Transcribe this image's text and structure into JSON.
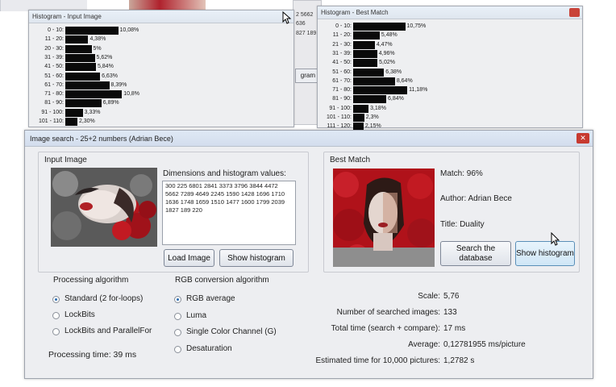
{
  "histogram_input": {
    "title": "Histogram - Input Image",
    "rows": [
      {
        "label": "0 - 10:",
        "pct": "10,08%",
        "value": 10.08
      },
      {
        "label": "11 - 20:",
        "pct": "4,38%",
        "value": 4.38
      },
      {
        "label": "20 - 30:",
        "pct": "5%",
        "value": 5.0
      },
      {
        "label": "31 - 39:",
        "pct": "5,62%",
        "value": 5.62
      },
      {
        "label": "41 - 50:",
        "pct": "5,84%",
        "value": 5.84
      },
      {
        "label": "51 - 60:",
        "pct": "6,63%",
        "value": 6.63
      },
      {
        "label": "61 - 70:",
        "pct": "8,39%",
        "value": 8.39
      },
      {
        "label": "71 - 80:",
        "pct": "10,8%",
        "value": 10.8
      },
      {
        "label": "81 - 90:",
        "pct": "6,89%",
        "value": 6.89
      },
      {
        "label": "91 - 100:",
        "pct": "3,33%",
        "value": 3.33
      },
      {
        "label": "101 - 110:",
        "pct": "2,30%",
        "value": 2.3
      }
    ]
  },
  "histogram_best": {
    "title": "Histogram - Best Match",
    "rows": [
      {
        "label": "0 - 10:",
        "pct": "10,75%",
        "value": 10.75
      },
      {
        "label": "11 - 20:",
        "pct": "5,48%",
        "value": 5.48
      },
      {
        "label": "21 - 30:",
        "pct": "4,47%",
        "value": 4.47
      },
      {
        "label": "31 - 39:",
        "pct": "4,96%",
        "value": 4.96
      },
      {
        "label": "41 - 50:",
        "pct": "5,02%",
        "value": 5.02
      },
      {
        "label": "51 - 60:",
        "pct": "6,38%",
        "value": 6.38
      },
      {
        "label": "61 - 70:",
        "pct": "8,64%",
        "value": 8.64
      },
      {
        "label": "71 - 80:",
        "pct": "11,18%",
        "value": 11.18
      },
      {
        "label": "81 - 90:",
        "pct": "6,84%",
        "value": 6.84
      },
      {
        "label": "91 - 100:",
        "pct": "3,18%",
        "value": 3.18
      },
      {
        "label": "101 - 110:",
        "pct": "2,3%",
        "value": 2.3
      },
      {
        "label": "111 - 120:",
        "pct": "2,15%",
        "value": 2.15
      }
    ]
  },
  "background": {
    "fragments": [
      "2 5662",
      "636",
      "827 189"
    ],
    "button_fragment": "gram"
  },
  "main": {
    "title": "Image search - 25+2 numbers (Adrian Bece)",
    "close_glyph": "✕",
    "input_group": "Input Image",
    "dims_label": "Dimensions and histogram values:",
    "dims_value": "300 225 6801 2841 3373 3796 3844 4472 5662 7289 4649 2245 1590 1428 1696 1710 1636 1748 1659 1510 1477 1600 1799 2039 1827 189 220",
    "load_button": "Load Image",
    "show_hist_button": "Show histogram",
    "proc_group": "Processing algorithm",
    "proc_options": [
      "Standard (2 for-loops)",
      "LockBits",
      "LockBits and ParallelFor"
    ],
    "proc_selected": 0,
    "proc_time": "Processing time: 39 ms",
    "rgb_group": "RGB conversion algorithm",
    "rgb_options": [
      "RGB average",
      "Luma",
      "Single Color Channel (G)",
      "Desaturation"
    ],
    "rgb_selected": 0,
    "best_group": "Best Match",
    "match": "Match: 96%",
    "author": "Author: Adrian Bece",
    "title_label": "Title:  Duality",
    "search_button": "Search the database",
    "show_hist_button2": "Show histogram",
    "stats": [
      {
        "label": "Scale:",
        "value": "5,76"
      },
      {
        "label": "Number of searched images:",
        "value": "133"
      },
      {
        "label": "Total time (search + compare):",
        "value": "17 ms"
      },
      {
        "label": "Average:",
        "value": "0,12781955 ms/picture"
      },
      {
        "label": "Estimated time for 10,000 pictures:",
        "value": "1,2782 s"
      }
    ]
  },
  "colors": {
    "bar": "#0a0a0a",
    "rose": "#b3151c",
    "radio_dot": "#2b6cb0"
  }
}
